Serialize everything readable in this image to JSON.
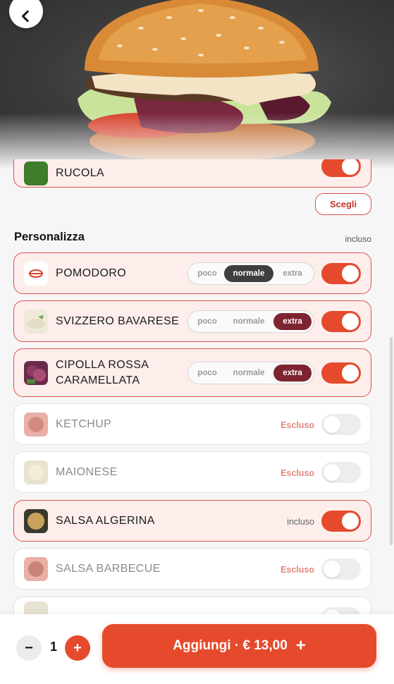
{
  "header": {
    "back_icon": "chevron-left-icon"
  },
  "top_item": {
    "label": "RUCOLA",
    "on": true
  },
  "choose_label": "Scegli",
  "section": {
    "title": "Personalizza",
    "note": "incluso"
  },
  "portion_options": [
    "poco",
    "normale",
    "extra"
  ],
  "items": [
    {
      "label": "POMODORO",
      "selected": "normale",
      "on": true
    },
    {
      "label": "SVIZZERO BAVARESE",
      "selected": "extra",
      "on": true
    },
    {
      "label_line1": "CIPOLLA ROSSA",
      "label_line2": "CARAMELLATA",
      "selected": "extra",
      "on": true
    },
    {
      "label": "KETCHUP",
      "status": "Escluso",
      "on": false
    },
    {
      "label": "MAIONESE",
      "status": "Escluso",
      "on": false
    },
    {
      "label": "SALSA ALGERINA",
      "status": "incluso",
      "on": true
    },
    {
      "label": "SALSA BARBECUE",
      "status": "Escluso",
      "on": false
    }
  ],
  "footer": {
    "quantity": "1",
    "minus_label": "−",
    "plus_label": "+",
    "add_label": "Aggiungi · € 13,00",
    "add_plus": "+"
  },
  "colors": {
    "accent": "#e54a2c",
    "extra": "#7e2330",
    "normal": "#3f3f3f"
  }
}
